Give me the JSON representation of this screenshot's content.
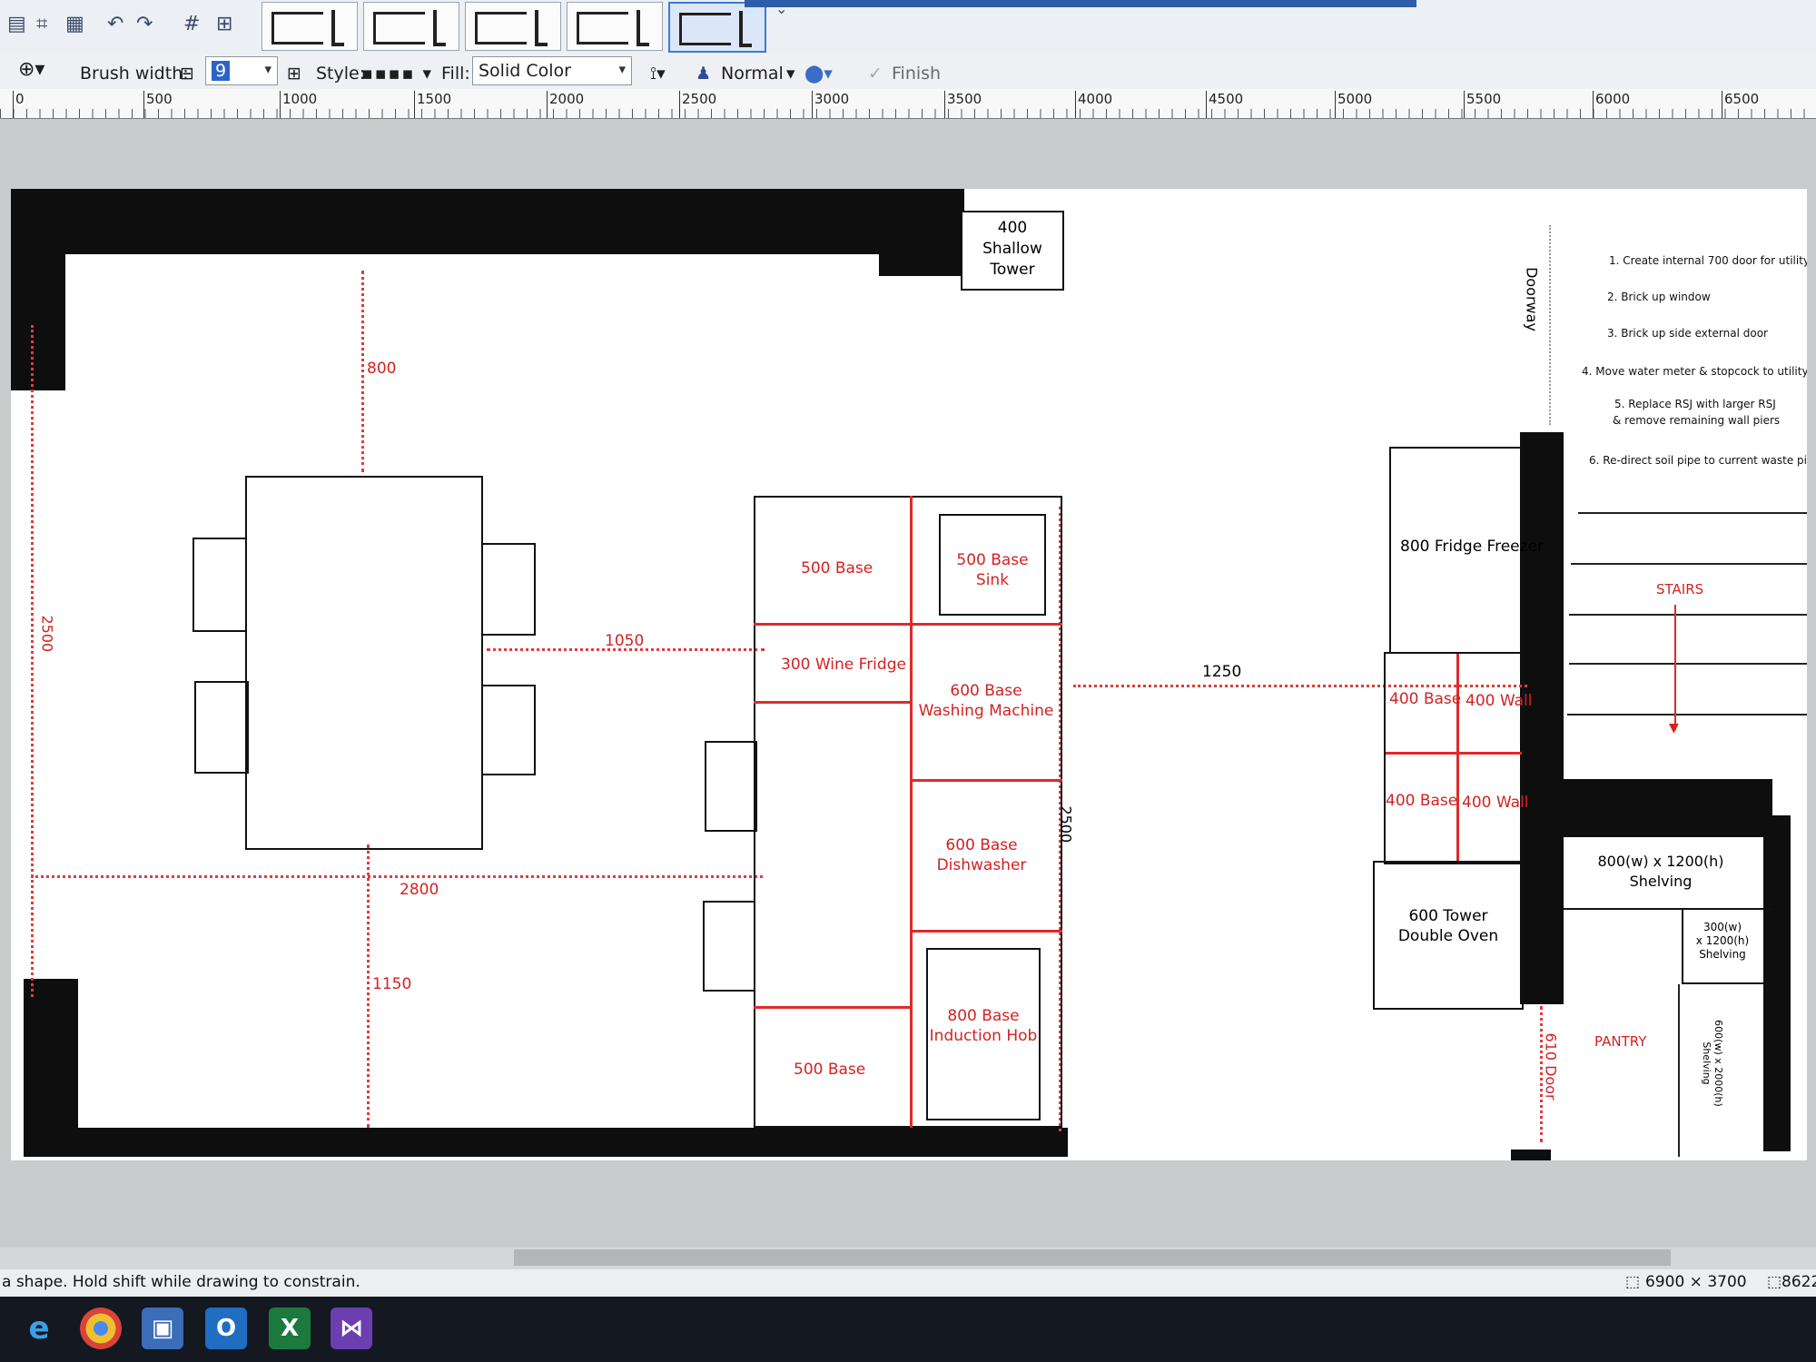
{
  "toolbar": {
    "brush_width_label": "Brush width:",
    "brush_width_value": "9",
    "style_label": "Style:",
    "fill_label": "Fill:",
    "fill_value": "Solid Color",
    "blend_mode": "Normal",
    "finish_label": "Finish",
    "icons": [
      "paste-icon",
      "crop-icon",
      "resize-icon",
      "undo-icon",
      "redo-icon",
      "grid-icon",
      "ruler-icon",
      "shape-icon",
      "antialias-icon",
      "blend-icon",
      "color-icon",
      "check-icon"
    ]
  },
  "ruler": {
    "ticks": [
      "0",
      "500",
      "1000",
      "1500",
      "2000",
      "2500",
      "3000",
      "3500",
      "4000",
      "4500",
      "5000",
      "5500",
      "6000",
      "6500"
    ]
  },
  "plan": {
    "shallow_tower": [
      "400",
      "Shallow",
      "Tower"
    ],
    "doorway": "Doorway",
    "notes": [
      "1. Create internal 700 door for utility",
      "2. Brick up window",
      "3. Brick up side external door",
      "4. Move water meter & stopcock to utility",
      "5. Replace RSJ with larger RSJ",
      "& remove remaining wall piers",
      "6. Re-direct soil pipe to current waste pipe"
    ],
    "dims": {
      "d800": "800",
      "d2500_left": "2500",
      "d1050": "1050",
      "d2800": "2800",
      "d1150": "1150",
      "d2500_island": "2500",
      "d1250": "1250"
    },
    "island": {
      "base_500_top": "500 Base",
      "sink": [
        "500 Base",
        "Sink"
      ],
      "wine_fridge": "300 Wine Fridge",
      "washing": [
        "600 Base",
        "Washing Machine"
      ],
      "dishwasher": [
        "600 Base",
        "Dishwasher"
      ],
      "hob": [
        "800 Base",
        "Induction Hob"
      ],
      "base_500_bottom": "500 Base"
    },
    "right_units": {
      "fridge": "800 Fridge Freezer",
      "base_1": "400 Base",
      "wall_1": "400 Wall",
      "base_2": "400 Base",
      "wall_2": "400 Wall",
      "oven": [
        "600 Tower",
        "Double Oven"
      ],
      "door": "610 Door"
    },
    "stairs": "STAIRS",
    "pantry": {
      "shelving_main": [
        "800(w) x 1200(h)",
        "Shelving"
      ],
      "shelving_small": [
        "300(w)",
        "x 1200(h)",
        "Shelving"
      ],
      "label": "PANTRY",
      "shelving_side": [
        "600(w) x 2000(h)",
        "Shelving"
      ]
    }
  },
  "status": {
    "hint": "a shape. Hold shift while drawing to constrain.",
    "image_size": "6900 × 3700",
    "selection_size": "8622,"
  },
  "colors": {
    "accent": "#2f5ea8",
    "plan_red": "#e02a2a",
    "wall": "#0e0e0e"
  },
  "taskbar": [
    "ie-icon",
    "chrome-icon",
    "paint-icon",
    "outlook-icon",
    "excel-icon",
    "visual-studio-icon"
  ]
}
